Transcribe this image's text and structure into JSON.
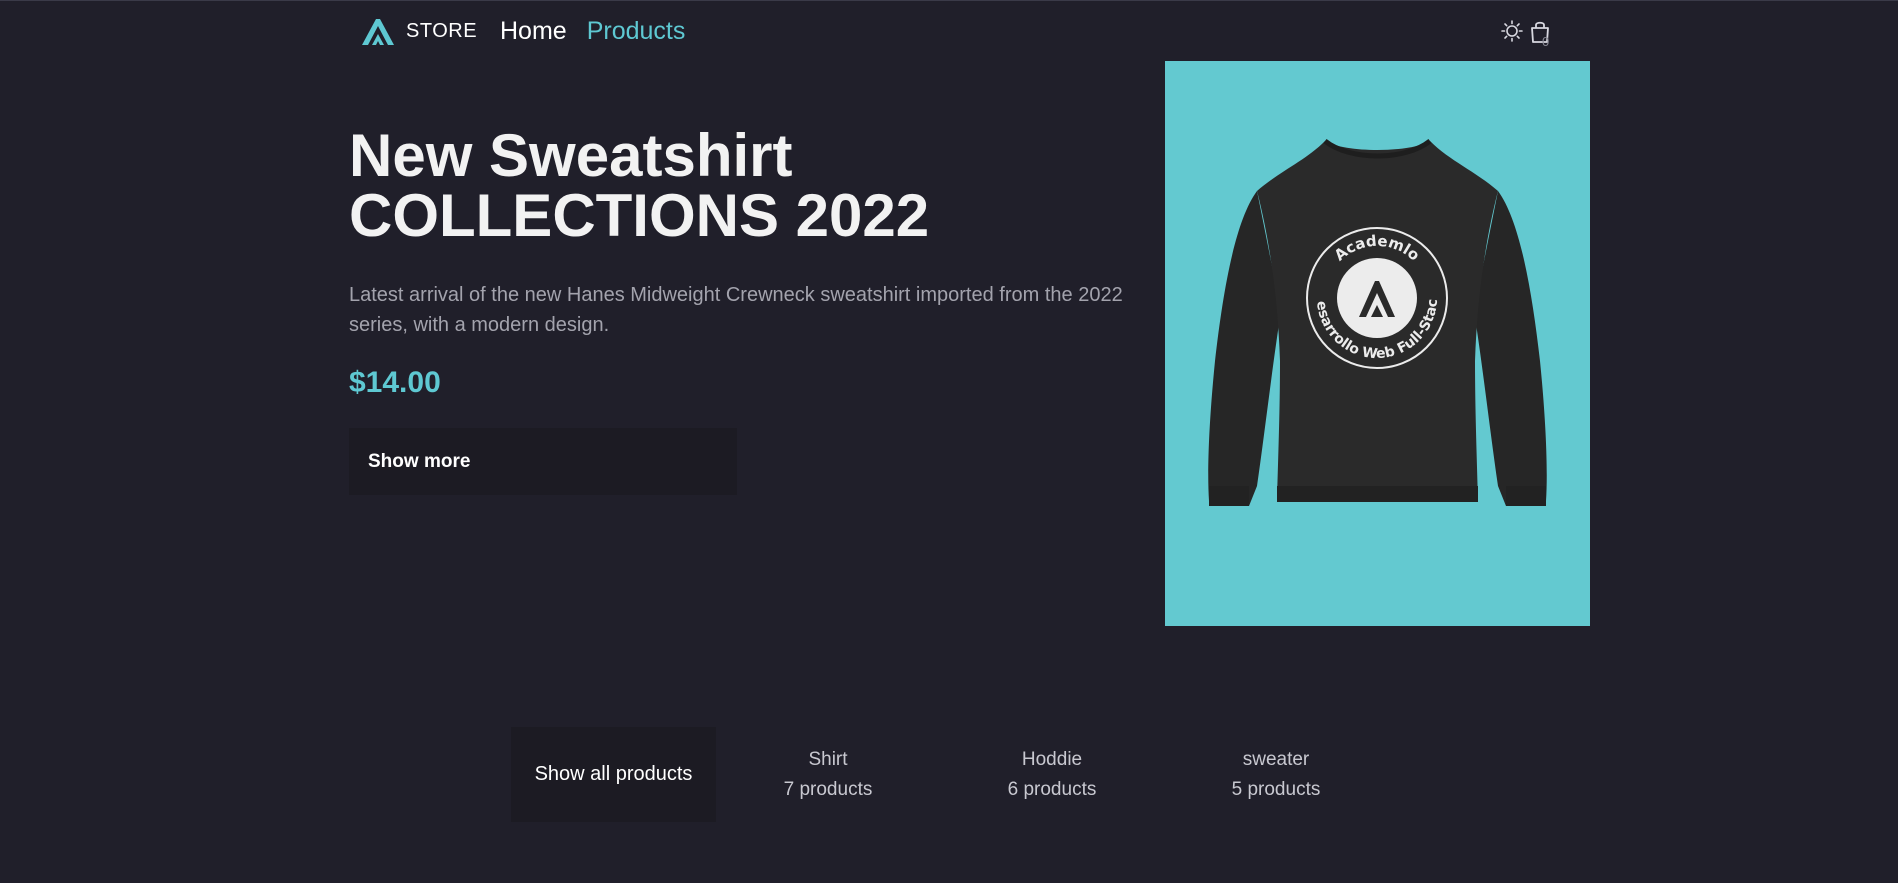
{
  "header": {
    "logo_text": "STORE",
    "nav": [
      {
        "label": "Home"
      },
      {
        "label": "Products"
      }
    ],
    "cart_count": "0",
    "icons": [
      "sun-icon",
      "shopping-bag-icon"
    ]
  },
  "hero": {
    "title_line1": "New Sweatshirt",
    "title_line2": "COLLECTIONS 2022",
    "description": "Latest arrival of the new Hanes Midweight Crewneck sweatshirt imported from the 2022 series, with a modern design.",
    "price": "$14.00",
    "button_label": "Show more",
    "image_badge_top": "Academlo",
    "image_badge_bottom": "Desarrollo Web Full-Stack"
  },
  "categories": {
    "all_label": "Show all products",
    "items": [
      {
        "name": "Shirt",
        "count": "7 products"
      },
      {
        "name": "Hoddie",
        "count": "6 products"
      },
      {
        "name": "sweater",
        "count": "5 products"
      }
    ]
  },
  "colors": {
    "background": "#201f2a",
    "accent": "#5ec8d2",
    "button_bg": "#1c1b23",
    "image_bg": "#63c9d0"
  }
}
